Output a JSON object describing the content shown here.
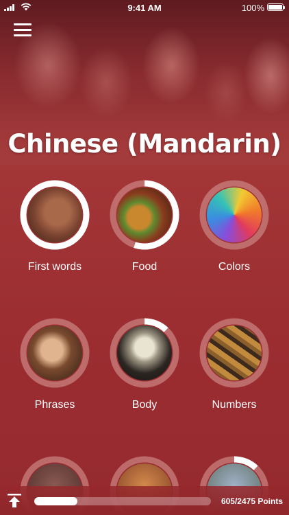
{
  "status_bar": {
    "time": "9:41 AM",
    "battery_percent": "100%",
    "icons": [
      "signal-icon",
      "wifi-icon",
      "battery-icon"
    ]
  },
  "header": {
    "menu_icon": "hamburger-menu-icon",
    "title": "Chinese (Mandarin)"
  },
  "colors": {
    "accent": "#9c2f32",
    "ring_track": "#c98080",
    "ring_fill": "#ffffff"
  },
  "categories": [
    {
      "label": "First words",
      "progress": 1.0,
      "image": "baby-face-photo"
    },
    {
      "label": "Food",
      "progress": 0.55,
      "image": "burger-fries-photo"
    },
    {
      "label": "Colors",
      "progress": 0.0,
      "image": "color-powder-photo"
    },
    {
      "label": "Phrases",
      "progress": 0.0,
      "image": "smiling-woman-photo"
    },
    {
      "label": "Body",
      "progress": 0.12,
      "image": "skeleton-photo"
    },
    {
      "label": "Numbers",
      "progress": 0.0,
      "image": "numbers-photo"
    },
    {
      "label": "",
      "progress": 0.0,
      "image": "partial-photo-1"
    },
    {
      "label": "",
      "progress": 0.0,
      "image": "partial-photo-2"
    },
    {
      "label": "",
      "progress": 0.12,
      "image": "partial-photo-3"
    }
  ],
  "footer": {
    "upload_icon": "upload-arrow-icon",
    "progress_fraction": 0.244,
    "points_text": "605/2475 Points"
  }
}
